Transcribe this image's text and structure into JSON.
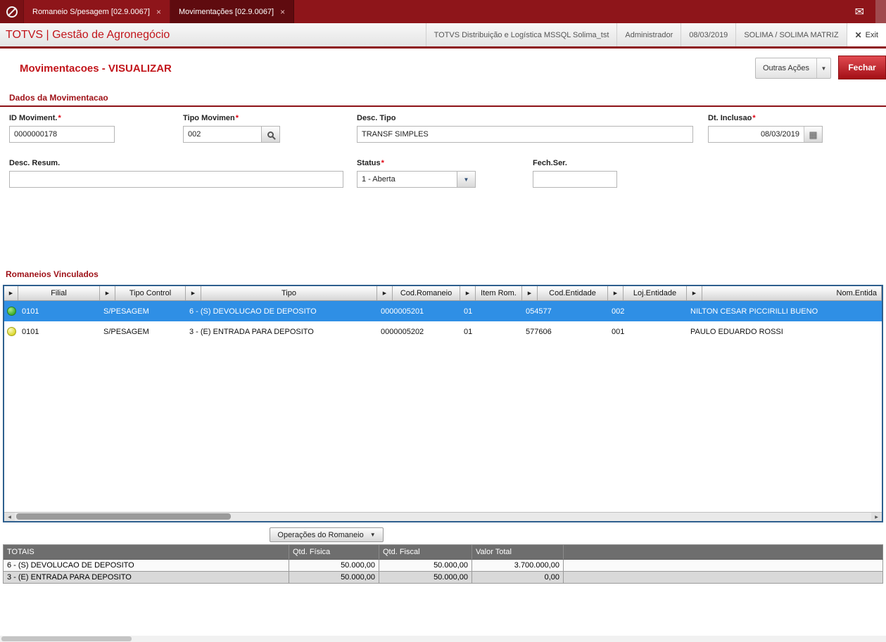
{
  "colors": {
    "topbar": "#8e151a",
    "topbar_active_tab": "#5f0b0f",
    "accent_red": "#c2151b",
    "selected_row": "#2f8fe5",
    "status_green": "#3fae2c",
    "status_yellow": "#dcd92e",
    "totals_header_bg": "#6e6e6e"
  },
  "window": {
    "tabs": [
      {
        "label": "Romaneio S/pesagem [02.9.0067]",
        "close": "×"
      },
      {
        "label": "Movimentações [02.9.0067]",
        "close": "×"
      }
    ]
  },
  "header": {
    "brand": "TOTVS | Gestão de Agronegócio",
    "environment": "TOTVS Distribuição e Logística MSSQL Solima_tst",
    "user": "Administrador",
    "date": "08/03/2019",
    "company": "SOLIMA / SOLIMA MATRIZ",
    "exit_label": "Exit"
  },
  "page": {
    "title": "Movimentacoes - VISUALIZAR",
    "other_actions_label": "Outras Ações",
    "close_label": "Fechar"
  },
  "form": {
    "section_title": "Dados da Movimentacao",
    "fields": {
      "id_moviment": {
        "label": "ID Moviment.",
        "required": "*",
        "value": "0000000178"
      },
      "tipo_movimen": {
        "label": "Tipo Movimen",
        "required": "*",
        "value": "002"
      },
      "desc_tipo": {
        "label": "Desc. Tipo",
        "value": "TRANSF SIMPLES"
      },
      "dt_inclusao": {
        "label": "Dt. Inclusao",
        "required": "*",
        "value": "08/03/2019"
      },
      "desc_resum": {
        "label": "Desc. Resum.",
        "value": ""
      },
      "status": {
        "label": "Status",
        "required": "*",
        "value": "1 - Aberta"
      },
      "fech_ser": {
        "label": "Fech.Ser.",
        "value": ""
      }
    }
  },
  "grid": {
    "section_title": "Romaneios Vinculados",
    "columns": [
      "Filial",
      "Tipo Control",
      "Tipo",
      "Cod.Romaneio",
      "Item Rom.",
      "Cod.Entidade",
      "Loj.Entidade",
      "Nom.Entida"
    ],
    "rows": [
      {
        "status": "green",
        "filial": "0101",
        "tipo_control": "S/PESAGEM",
        "tipo": "6 - (S) DEVOLUCAO DE DEPOSITO",
        "cod_romaneio": "0000005201",
        "item_rom": "01",
        "cod_entidade": "054577",
        "loj_entidade": "002",
        "nom_entidade": "NILTON CESAR PICCIRILLI BUENO"
      },
      {
        "status": "yellow",
        "filial": "0101",
        "tipo_control": "S/PESAGEM",
        "tipo": "3 - (E) ENTRADA PARA DEPOSITO",
        "cod_romaneio": "0000005202",
        "item_rom": "01",
        "cod_entidade": "577606",
        "loj_entidade": "001",
        "nom_entidade": "PAULO EDUARDO ROSSI"
      }
    ]
  },
  "operations": {
    "label": "Operações do Romaneio"
  },
  "totals": {
    "columns": [
      "TOTAIS",
      "Qtd. Física",
      "Qtd. Fiscal",
      "Valor Total"
    ],
    "rows": [
      {
        "label": "6 - (S) DEVOLUCAO DE DEPOSITO",
        "qtd_fisica": "50.000,00",
        "qtd_fiscal": "50.000,00",
        "valor_total": "3.700.000,00"
      },
      {
        "label": "3 - (E) ENTRADA PARA DEPOSITO",
        "qtd_fisica": "50.000,00",
        "qtd_fiscal": "50.000,00",
        "valor_total": "0,00"
      }
    ]
  }
}
